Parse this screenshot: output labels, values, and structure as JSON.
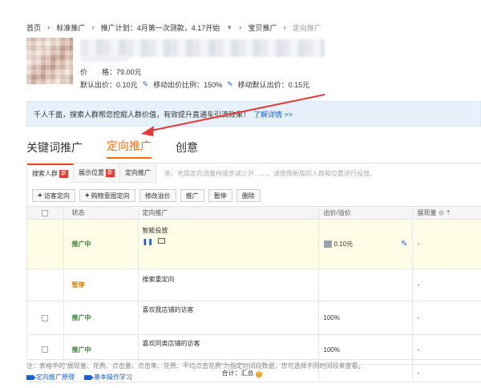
{
  "breadcrumb": {
    "items": [
      "首页",
      "标准推广",
      "推广计划：4月第一次测款，4.17开始",
      "宝贝推广"
    ],
    "current": "定向推广"
  },
  "product": {
    "price": "价　　格：79.00元",
    "default_bid": "默认出价：0.10元",
    "mobile_ratio": "移动出价比例：150%",
    "mobile_default_bid": "移动默认出价：0.15元"
  },
  "tip": {
    "text": "千人千面，搜索人群帮您挖掘人群价值，有效提升直通车引流效果！",
    "link": "了解详情 >>"
  },
  "main_tabs": [
    "关键词推广",
    "定向推广",
    "创意"
  ],
  "sub_tabs": [
    {
      "label": "搜索人群",
      "badge": "新"
    },
    {
      "label": "展示位置",
      "badge": "新"
    },
    {
      "label": "定向推广",
      "badge": ""
    }
  ],
  "sub_note": "亲，老版定向流量构造步减少开……，请使用新版的人群和位置进行投放。",
  "toolbar": {
    "add_visitor": "访客定向",
    "add_intent": "购物意图定向",
    "modify_bid": "修改溢价",
    "promote": "推广",
    "pause": "暂停",
    "delete": "删除"
  },
  "table": {
    "headers": [
      "",
      "状态",
      "定向推广",
      "出价/溢价",
      "展现量"
    ],
    "rows": [
      {
        "status": "推广中",
        "status_type": "on",
        "name": "智能投放",
        "bid": "0.10元",
        "impressions": "-"
      },
      {
        "status": "暂停",
        "status_type": "off",
        "name": "搜索重定向",
        "bid": "",
        "impressions": "-"
      },
      {
        "status": "推广中",
        "status_type": "on",
        "name": "喜欢我店铺的访客",
        "bid": "100%",
        "impressions": "-"
      },
      {
        "status": "推广中",
        "status_type": "on",
        "name": "喜欢同类店铺的访客",
        "bid": "100%",
        "impressions": "-"
      }
    ],
    "total_label": "合计：汇总",
    "total_value": "-"
  },
  "footnote": "注：表格中的\"展现量、花费、点击量、点击率、花费、平均点击花费\"为指定时间段数据，您可选择不同时间段来查看。",
  "links": [
    "定向推广原理",
    "基本操作学习"
  ],
  "colors": {
    "accent": "#ff6a00",
    "link": "#1a5fd0",
    "active_status": "#2e8b2e",
    "paused_status": "#e07a00",
    "badge": "#e53935",
    "arrow": "#e53935"
  }
}
